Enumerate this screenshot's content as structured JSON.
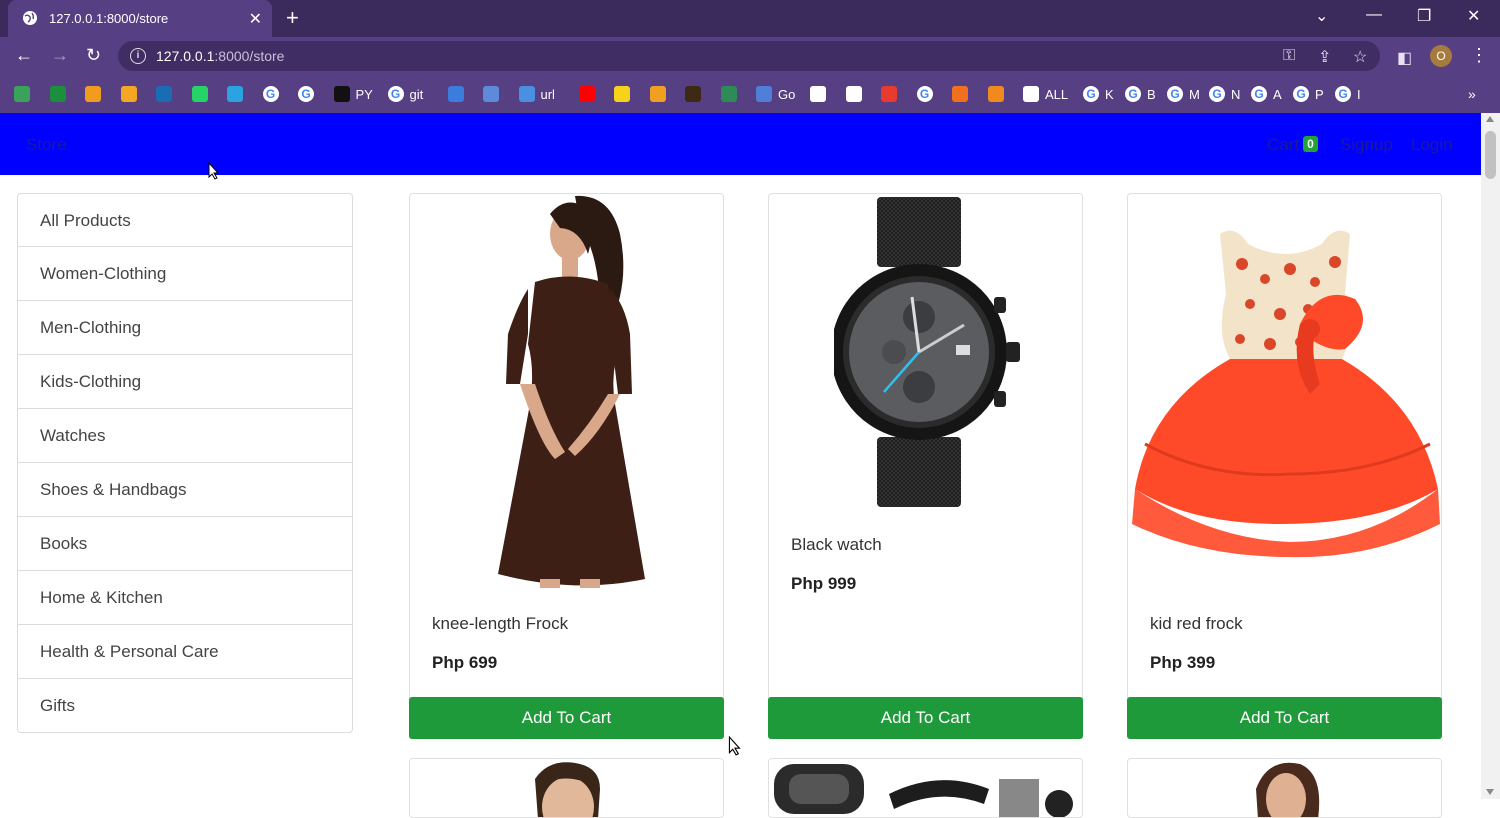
{
  "browser": {
    "tab_title": "127.0.0.1:8000/store",
    "url_host": "127.0.0.1",
    "url_path": ":8000/store",
    "profile_initial": "O"
  },
  "bookmarks": [
    {
      "label": "",
      "icon": "green-app-icon",
      "color": "#3aa35b"
    },
    {
      "label": "",
      "icon": "plus-app-icon",
      "color": "#1c8f3c"
    },
    {
      "label": "",
      "icon": "orange-app-icon",
      "color": "#f29c1f"
    },
    {
      "label": "",
      "icon": "chart-icon",
      "color": "#f5a623"
    },
    {
      "label": "",
      "icon": "ieee-icon",
      "color": "#1a6db5"
    },
    {
      "label": "",
      "icon": "whatsapp-icon",
      "color": "#25d366"
    },
    {
      "label": "",
      "icon": "telegram-icon",
      "color": "#2aa3e0"
    },
    {
      "label": "",
      "icon": "google-icon",
      "color": "#ffffff"
    },
    {
      "label": "",
      "icon": "google-icon",
      "color": "#ffffff"
    },
    {
      "label": "PY",
      "icon": "github-icon",
      "color": "#111111"
    },
    {
      "label": "git",
      "icon": "google-icon",
      "color": "#ffffff"
    },
    {
      "label": "",
      "icon": "blue-doc-icon",
      "color": "#3b7ddd"
    },
    {
      "label": "",
      "icon": "store-icon",
      "color": "#5d8bd9"
    },
    {
      "label": "url",
      "icon": "cloud-icon",
      "color": "#4a90e2"
    },
    {
      "label": "",
      "icon": "youtube-icon",
      "color": "#ff0000"
    },
    {
      "label": "",
      "icon": "p-icon",
      "color": "#f7d11a"
    },
    {
      "label": "",
      "icon": "video-icon",
      "color": "#f0a020"
    },
    {
      "label": "",
      "icon": "crown-icon",
      "color": "#3d2a14"
    },
    {
      "label": "",
      "icon": "circle-icon",
      "color": "#2e8b57"
    },
    {
      "label": "Go",
      "icon": "swirl-icon",
      "color": "#4f7fd9"
    },
    {
      "label": "",
      "icon": "bird-icon",
      "color": "#ffffff"
    },
    {
      "label": "",
      "icon": "cl-icon",
      "color": "#ffffff"
    },
    {
      "label": "",
      "icon": "yandex-icon",
      "color": "#e63b2e"
    },
    {
      "label": "",
      "icon": "google-icon",
      "color": "#ffffff"
    },
    {
      "label": "",
      "icon": "flame-icon",
      "color": "#f07020"
    },
    {
      "label": "",
      "icon": "eye-icon",
      "color": "#f08a1c"
    },
    {
      "label": "ALL",
      "icon": "globe-icon",
      "color": "#ffffff"
    },
    {
      "label": "K",
      "icon": "google-icon",
      "color": "#ffffff"
    },
    {
      "label": "B",
      "icon": "google-icon",
      "color": "#ffffff"
    },
    {
      "label": "M",
      "icon": "google-icon",
      "color": "#ffffff"
    },
    {
      "label": "N",
      "icon": "google-icon",
      "color": "#ffffff"
    },
    {
      "label": "A",
      "icon": "google-icon",
      "color": "#ffffff"
    },
    {
      "label": "P",
      "icon": "google-icon",
      "color": "#ffffff"
    },
    {
      "label": "I",
      "icon": "google-icon",
      "color": "#ffffff"
    }
  ],
  "navbar": {
    "brand": "Store",
    "cart_label": "Cart",
    "cart_count": "0",
    "signup": "Signup",
    "login": "Login",
    "background": "#0000ff"
  },
  "categories": [
    "All Products",
    "Women-Clothing",
    "Men-Clothing",
    "Kids-Clothing",
    "Watches",
    "Shoes & Handbags",
    "Books",
    "Home & Kitchen",
    "Health & Personal Care",
    "Gifts"
  ],
  "products": [
    {
      "name": "knee-length Frock",
      "price": "Php 699",
      "button": "Add To Cart"
    },
    {
      "name": "Black watch",
      "price": "Php 999",
      "button": "Add To Cart"
    },
    {
      "name": "kid red frock",
      "price": "Php 399",
      "button": "Add To Cart"
    }
  ],
  "colors": {
    "add_to_cart": "#1f9a3a",
    "cart_badge": "#23a23a"
  }
}
